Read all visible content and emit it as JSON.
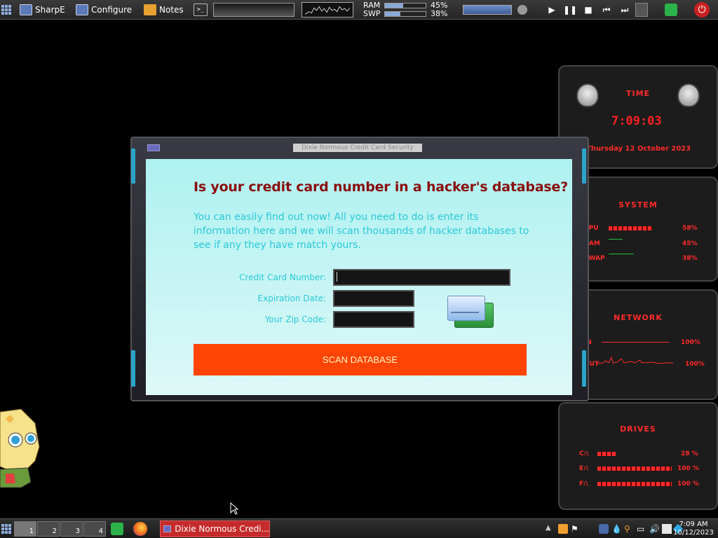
{
  "top_panel": {
    "app1_label": "SharpE",
    "app2_label": "Configure",
    "app3_label": "Notes",
    "terminal_label": ">_",
    "ram_label": "RAM",
    "ram_pct": "45%",
    "swp_label": "SWP",
    "swp_pct": "38%",
    "ram_level": 0.45,
    "swp_level": 0.38
  },
  "dialog": {
    "title": "Dixie Normous Credit Card Security",
    "heading": "Is your credit card number in a hacker's database?",
    "blurb": "You can easily find out now! All you need to do is enter its information here and we will scan thousands of hacker databases to see if any they have match yours.",
    "card_number_label": "Credit Card Number:",
    "expiration_label": "Expiration Date:",
    "zip_label": "Your Zip Code:",
    "card_number_value": "",
    "expiration_value": "",
    "zip_value": "",
    "scan_button": "SCAN DATABASE"
  },
  "widgets": {
    "time": {
      "title": "TIME",
      "clock": "7:09:03",
      "date": "Thursday 12 October 2023"
    },
    "system": {
      "title": "SYSTEM",
      "rows": [
        {
          "label": "CPU",
          "pct": "58%"
        },
        {
          "label": "RAM",
          "pct": "45%"
        },
        {
          "label": "SWAP",
          "pct": "38%"
        }
      ]
    },
    "network": {
      "title": "NETWORK",
      "rows": [
        {
          "label": "IN",
          "value": "100%"
        },
        {
          "label": "OUT",
          "value": "100%"
        }
      ]
    },
    "drives": {
      "title": "DRIVES",
      "rows": [
        {
          "label": "C:\\",
          "pct": "28 %"
        },
        {
          "label": "E:\\",
          "pct": "100 %"
        },
        {
          "label": "F:\\",
          "pct": "100 %"
        }
      ]
    }
  },
  "taskbar": {
    "desktops": [
      "1",
      "2",
      "3",
      "4"
    ],
    "active_task": "Dixie Normous Credi...",
    "time": "7:09 AM",
    "date": "10/12/2023"
  },
  "colors": {
    "accent_red": "#ff2a2a",
    "scan_button": "#ff4405",
    "dialog_bg": "#aff1f1",
    "heading": "#8a0d0d",
    "text_cyan": "#2ac9d6"
  }
}
